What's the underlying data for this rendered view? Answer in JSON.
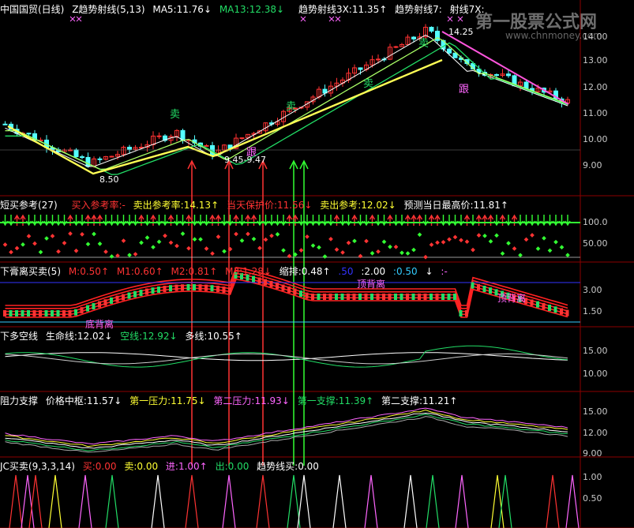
{
  "panels": {
    "main": {
      "title": "中国国贸(日线)",
      "items": [
        {
          "label": "Z趋势射线(5,13)",
          "color": "#ffffff"
        },
        {
          "label": "MA5:11.76↓",
          "color": "#ffffff"
        },
        {
          "label": "MA13:12.38↓",
          "color": "#22dd66"
        },
        {
          "label": "趋势射线3X:11.35↑",
          "color": "#ffffff"
        },
        {
          "label": "趋势射线7:",
          "color": "#ffffff"
        },
        {
          "label": "射线7X:",
          "color": "#ffffff"
        }
      ],
      "y_ticks": [
        "14.00",
        "13.00",
        "12.00",
        "11.00",
        "10.00",
        "9.00"
      ],
      "annotations": {
        "high": "14.25",
        "low": "8.50",
        "mid": "9.45-9.47",
        "sell": "卖",
        "follow": "跟"
      }
    },
    "short": {
      "title": "短买参考(27)",
      "items": [
        {
          "label": "买入参考率:-",
          "color": "#ff3333"
        },
        {
          "label": "卖出参考率:14.13↑",
          "color": "#ffff33"
        },
        {
          "label": "当天保护价:11.56↓",
          "color": "#ff3333"
        },
        {
          "label": "卖出参考:12.02↓",
          "color": "#ffff33"
        },
        {
          "label": "预测当日最高价:11.81↑",
          "color": "#ffffff"
        }
      ],
      "y_ticks": [
        "100.0",
        "50.00"
      ]
    },
    "paste": {
      "title": "下膏离买卖(5)",
      "items": [
        {
          "label": "M:0.50↑",
          "color": "#ff3333"
        },
        {
          "label": "M1:0.60↑",
          "color": "#ff3333"
        },
        {
          "label": "M2:0.81↑",
          "color": "#ff3333"
        },
        {
          "label": "M3:1.28↓",
          "color": "#ff3333"
        },
        {
          "label": "缩排:0.48↑",
          "color": "#ffffff"
        },
        {
          "label": ".50",
          "color": "#3333ff"
        },
        {
          "label": ":2.00",
          "color": "#ffffff"
        },
        {
          "label": ":0.50",
          "color": "#33ccff"
        },
        {
          "label": "↓",
          "color": "#ffffff"
        },
        {
          "label": ":-",
          "color": "#ff66ff"
        }
      ],
      "y_ticks": [
        "3.00",
        "1.50"
      ],
      "annotations": {
        "top": "顶背离",
        "top2": "顶背离",
        "bottom": "底背离"
      }
    },
    "duokong": {
      "title": "下多空线",
      "items": [
        {
          "label": "生命线:12.02↓",
          "color": "#ffffff"
        },
        {
          "label": "空线:12.92↓",
          "color": "#22dd66"
        },
        {
          "label": "多线:10.55↑",
          "color": "#ffffff"
        }
      ],
      "y_ticks": [
        "15.00",
        "10.00"
      ]
    },
    "support": {
      "title": "阻力支撑",
      "items": [
        {
          "label": "价格中枢:11.57↓",
          "color": "#ffffff"
        },
        {
          "label": "第一压力:11.75↓",
          "color": "#ffff33"
        },
        {
          "label": "第二压力:11.93↓",
          "color": "#ff66ff"
        },
        {
          "label": "第一支撑:11.39↑",
          "color": "#22dd66"
        },
        {
          "label": "第二支撑:11.21↑",
          "color": "#ffffff"
        }
      ],
      "y_ticks": [
        "15.00",
        "12.00",
        "9.00"
      ]
    },
    "jc": {
      "title": "JC买卖(9,3,3,14)",
      "items": [
        {
          "label": "买:0.00",
          "color": "#ff3333"
        },
        {
          "label": "卖:0.00",
          "color": "#ffff33"
        },
        {
          "label": "进:1.00↑",
          "color": "#ff66ff"
        },
        {
          "label": "出:0.00",
          "color": "#22dd66"
        },
        {
          "label": "趋势线买:0.00",
          "color": "#ffffff"
        }
      ],
      "y_ticks": [
        "1.00",
        "0.50"
      ]
    }
  },
  "watermark": {
    "line1": "第一股票公式网",
    "line2": "www.chnmoney.com"
  },
  "colors": {
    "up": "#ff3232",
    "down": "#54ffff",
    "grid": "#8b0000",
    "bg": "#000000"
  }
}
